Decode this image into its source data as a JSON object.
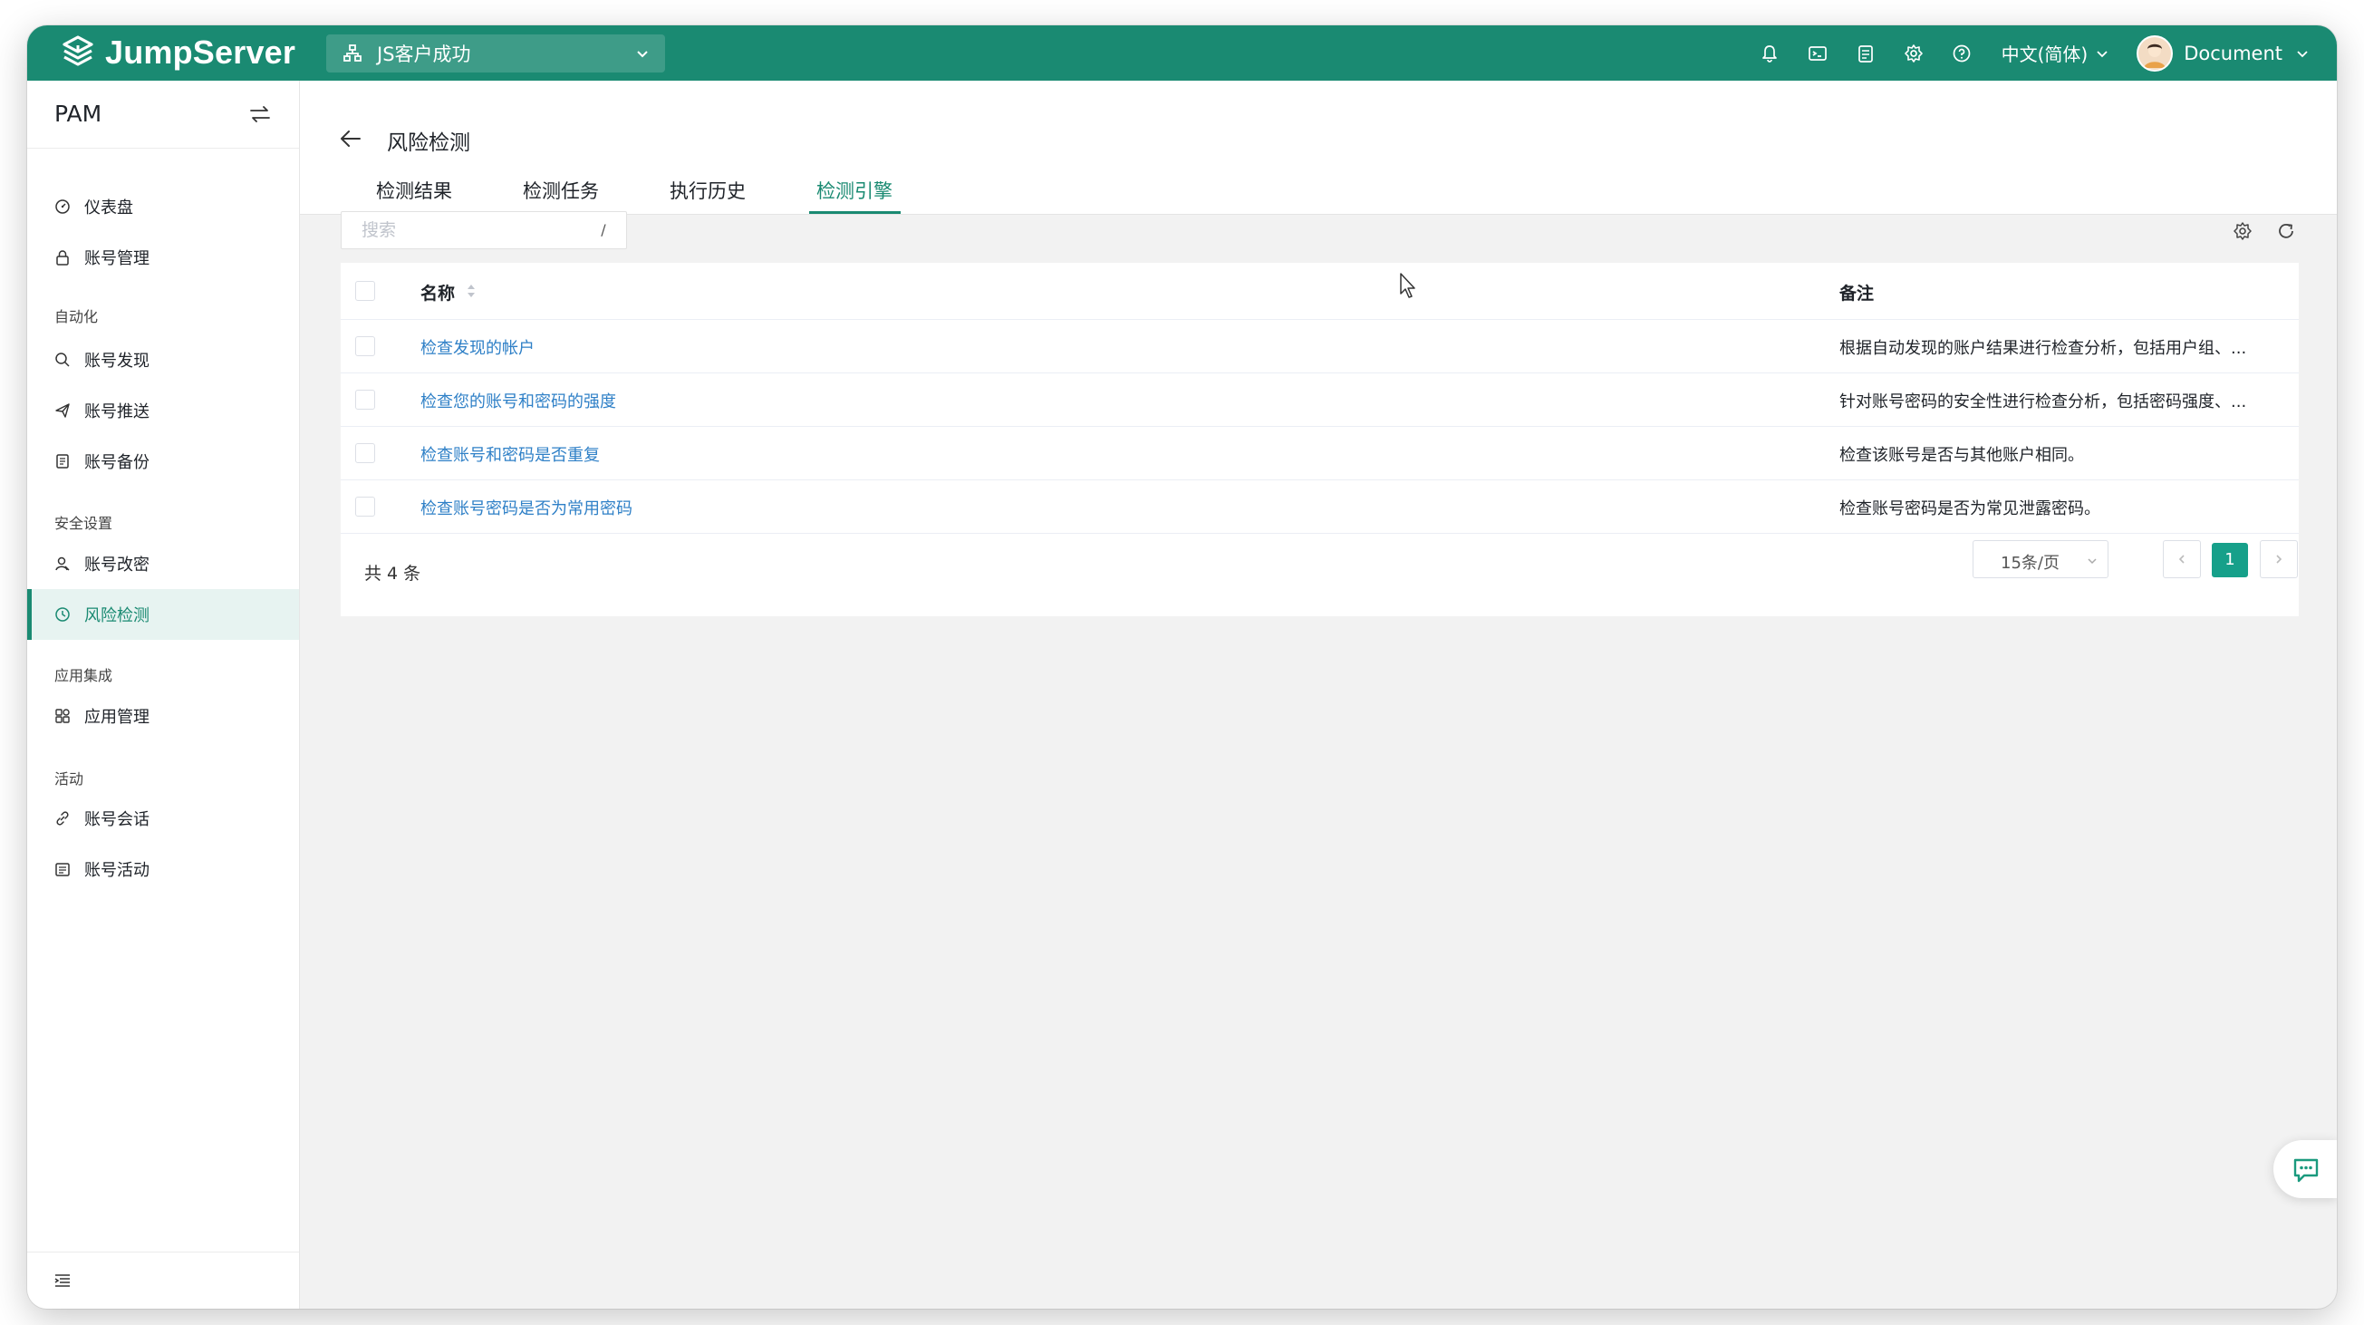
{
  "app": {
    "logo_text": "JumpServer"
  },
  "topbar": {
    "org_name": "JS客户成功",
    "language": "中文(简体)",
    "user_name": "Document",
    "icons": [
      "bell-icon",
      "terminal-icon",
      "ticket-icon",
      "settings-icon",
      "help-icon"
    ]
  },
  "sidebar": {
    "title": "PAM",
    "items": [
      {
        "label": "仪表盘",
        "icon": "dashboard-icon"
      },
      {
        "label": "账号管理",
        "icon": "lock-icon"
      },
      {
        "label": "账号发现",
        "icon": "search-icon"
      },
      {
        "label": "账号推送",
        "icon": "send-icon"
      },
      {
        "label": "账号备份",
        "icon": "backup-icon"
      },
      {
        "label": "账号改密",
        "icon": "key-change-icon"
      },
      {
        "label": "风险检测",
        "icon": "risk-detect-icon"
      },
      {
        "label": "应用管理",
        "icon": "apps-icon"
      },
      {
        "label": "账号会话",
        "icon": "link-icon"
      },
      {
        "label": "账号活动",
        "icon": "activity-icon"
      }
    ],
    "groups": [
      "自动化",
      "安全设置",
      "应用集成",
      "活动"
    ],
    "active": "风险检测"
  },
  "page": {
    "title": "风险检测",
    "tabs": [
      "检测结果",
      "检测任务",
      "执行历史",
      "检测引擎"
    ],
    "active_tab": "检测引擎"
  },
  "search": {
    "placeholder": "搜索",
    "shortcut": "/"
  },
  "table": {
    "columns": [
      "名称",
      "备注"
    ],
    "rows": [
      {
        "name": "检查发现的帐户",
        "note": "根据自动发现的账户结果进行检查分析，包括用户组、..."
      },
      {
        "name": "检查您的账号和密码的强度",
        "note": "针对账号密码的安全性进行检查分析，包括密码强度、..."
      },
      {
        "name": "检查账号和密码是否重复",
        "note": "检查该账号是否与其他账户相同。"
      },
      {
        "name": "检查账号密码是否为常用密码",
        "note": "检查账号密码是否为常见泄露密码。"
      }
    ]
  },
  "pagination": {
    "total_text": "共 4 条",
    "page_size": "15条/页",
    "current_page": "1"
  },
  "colors": {
    "brand": "#1a8a72",
    "link": "#2f80c7",
    "page_active": "#16a08a"
  }
}
